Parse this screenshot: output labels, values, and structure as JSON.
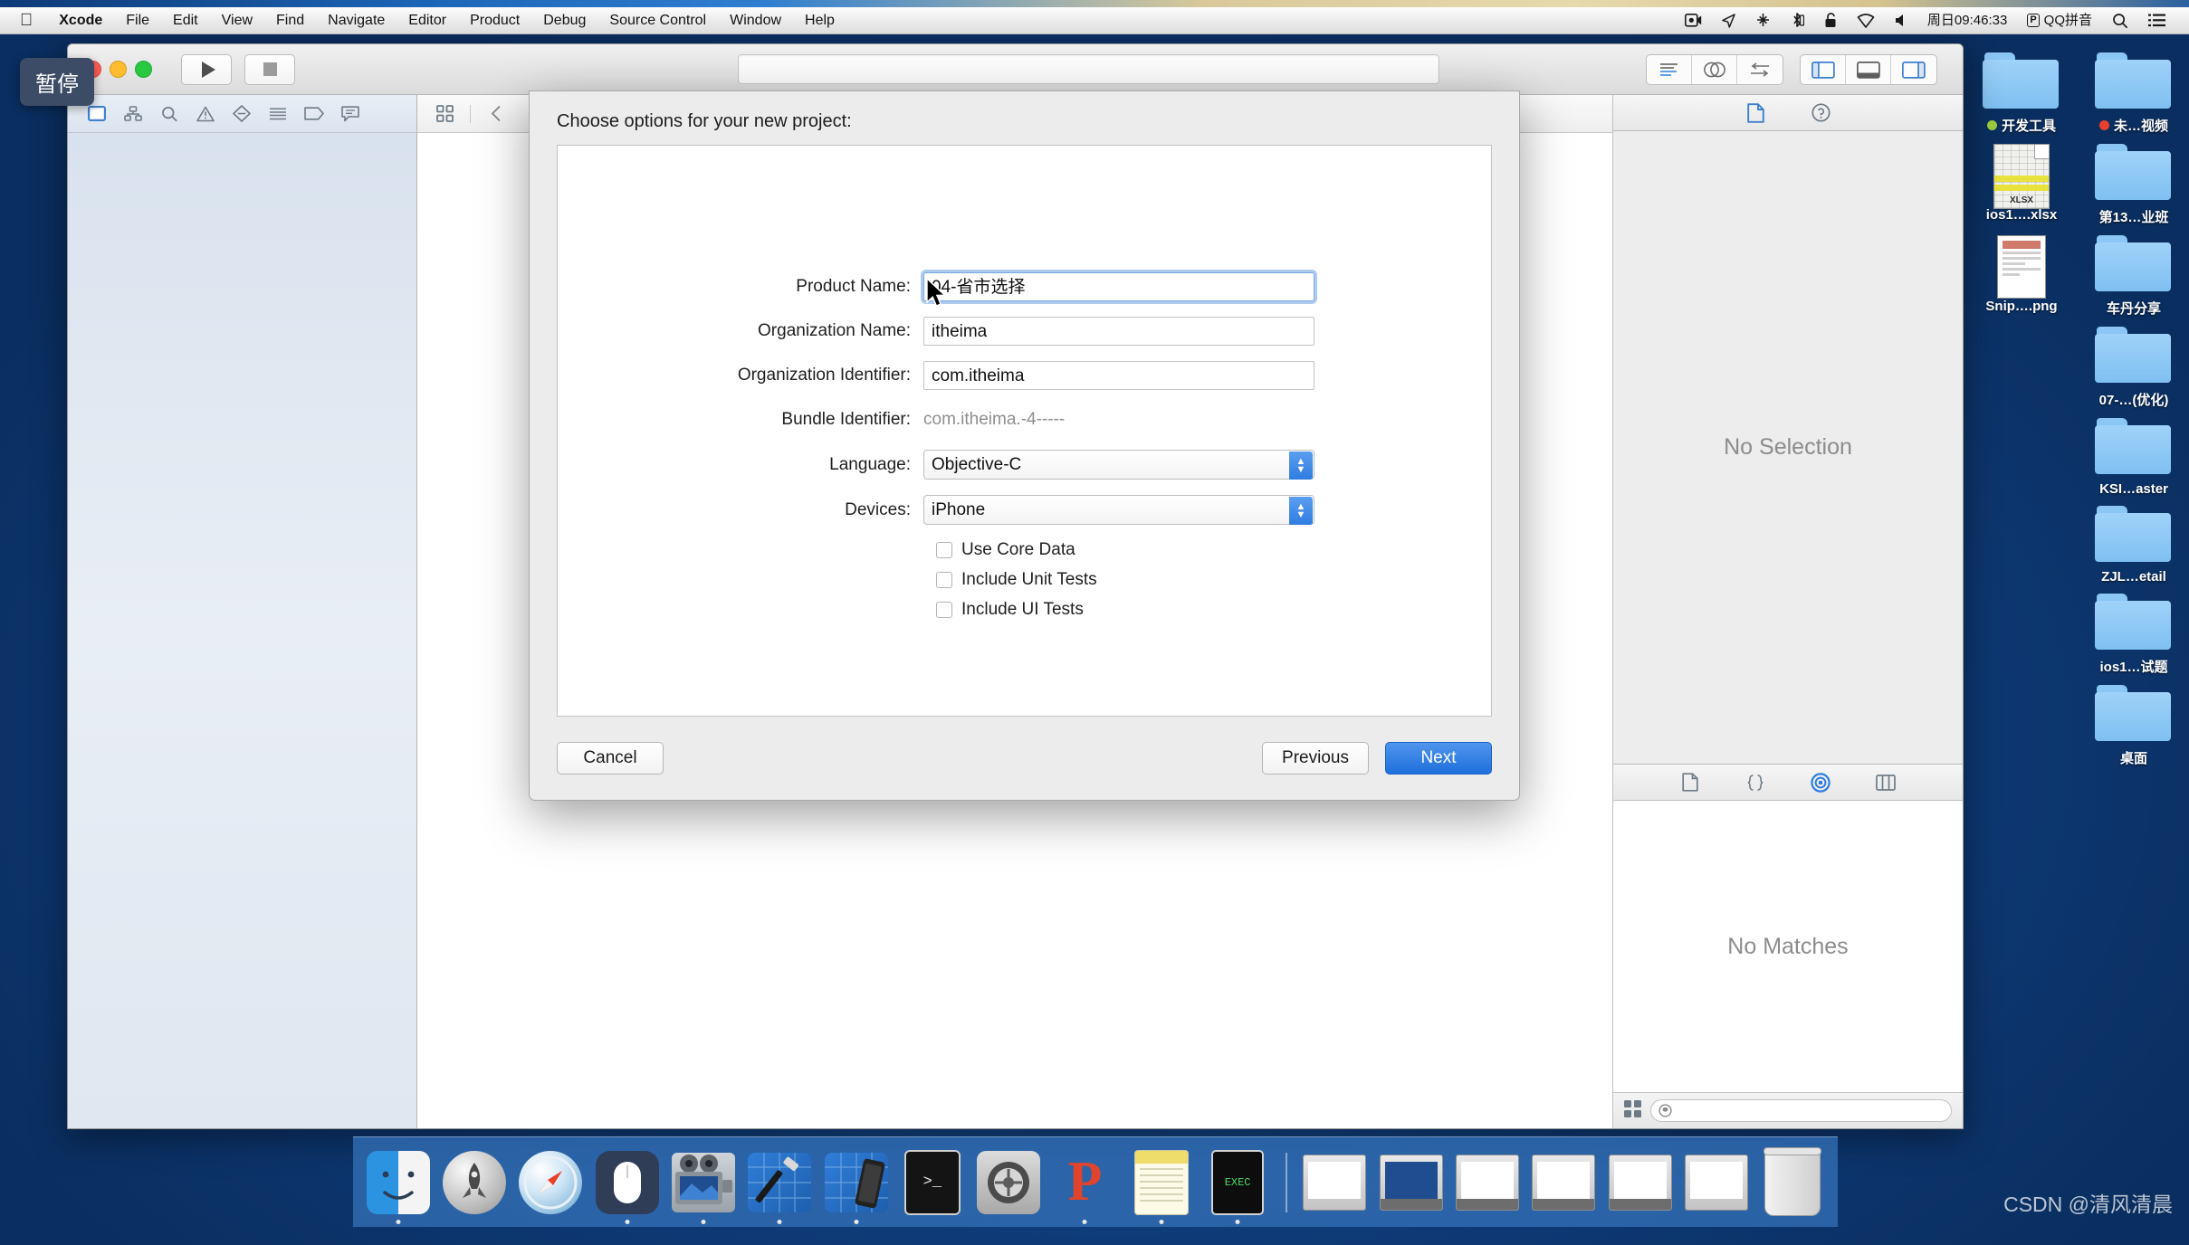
{
  "menubar": {
    "apple_icon": "apple-logo-icon",
    "items": [
      {
        "label": "Xcode",
        "bold": true
      },
      {
        "label": "File",
        "bold": false
      },
      {
        "label": "Edit",
        "bold": false
      },
      {
        "label": "View",
        "bold": false
      },
      {
        "label": "Find",
        "bold": false
      },
      {
        "label": "Navigate",
        "bold": false
      },
      {
        "label": "Editor",
        "bold": false
      },
      {
        "label": "Product",
        "bold": false
      },
      {
        "label": "Debug",
        "bold": false
      },
      {
        "label": "Source Control",
        "bold": false
      },
      {
        "label": "Window",
        "bold": false
      },
      {
        "label": "Help",
        "bold": false
      }
    ],
    "status": {
      "screen_recording_icon": "screen-recording-icon",
      "location_icon": "location-arrow-icon",
      "airdrop_icon": "airdrop-icon",
      "bluetooth_icon": "bluetooth-icon",
      "lock_icon": "lock-icon",
      "wifi_icon": "wifi-icon",
      "volume_icon": "volume-icon",
      "clock": "周日09:46:33",
      "ime_badge": "P",
      "ime_label": "QQ拼音",
      "search_icon": "search-icon",
      "control_center_icon": "control-center-icon"
    }
  },
  "pause_badge": {
    "label": "暂停"
  },
  "xcode": {
    "toolbar": {
      "run_icon": "run-play-icon",
      "stop_icon": "stop-square-icon",
      "editor_modes": [
        "standard-editor-icon",
        "assistant-editor-icon",
        "version-editor-icon"
      ],
      "view_toggles": [
        "navigator-toggle-icon",
        "debug-area-toggle-icon",
        "utilities-toggle-icon"
      ]
    },
    "navigator": {
      "tabs": [
        "project-navigator-icon",
        "symbol-navigator-icon",
        "find-navigator-icon",
        "issue-navigator-icon",
        "test-navigator-icon",
        "debug-navigator-icon",
        "breakpoint-navigator-icon",
        "report-navigator-icon"
      ]
    },
    "jumpbar": {
      "related_items_icon": "related-items-icon",
      "back_icon": "chevron-left-icon",
      "forward_icon": "chevron-right-icon"
    },
    "utilities": {
      "top_tabs": [
        "file-inspector-icon",
        "quick-help-icon"
      ],
      "top_empty_text": "No Selection",
      "bottom_tabs": [
        "file-template-library-icon",
        "code-snippet-library-icon",
        "object-library-icon",
        "media-library-icon"
      ],
      "bottom_empty_text": "No Matches",
      "library_grid_icon": "library-grid-icon",
      "library_filter_icon": "filter-icon",
      "library_filter_placeholder": ""
    }
  },
  "sheet": {
    "title": "Choose options for your new project:",
    "fields": [
      {
        "label": "Product Name:",
        "value": "04-省市选择",
        "type": "text",
        "focused": true
      },
      {
        "label": "Organization Name:",
        "value": "itheima",
        "type": "text",
        "focused": false
      },
      {
        "label": "Organization Identifier:",
        "value": "com.itheima",
        "type": "text",
        "focused": false
      },
      {
        "label": "Bundle Identifier:",
        "value": "com.itheima.-4-----",
        "type": "static",
        "focused": false
      },
      {
        "label": "Language:",
        "value": "Objective-C",
        "type": "select",
        "focused": false
      },
      {
        "label": "Devices:",
        "value": "iPhone",
        "type": "select",
        "focused": false
      }
    ],
    "checkboxes": [
      {
        "label": "Use Core Data",
        "checked": false
      },
      {
        "label": "Include Unit Tests",
        "checked": false
      },
      {
        "label": "Include UI Tests",
        "checked": false
      }
    ],
    "buttons": {
      "cancel": "Cancel",
      "previous": "Previous",
      "next": "Next"
    },
    "accent_color": "#1f6fdc"
  },
  "desktop": {
    "icons": [
      {
        "name": "开发工具",
        "kind": "folder",
        "tag": "#9ccc3f"
      },
      {
        "name": "未…视频",
        "kind": "folder",
        "tag": "#e8402a"
      },
      {
        "name": "ios1….xlsx",
        "kind": "xlsx",
        "tag": ""
      },
      {
        "name": "第13…业班",
        "kind": "folder",
        "tag": ""
      },
      {
        "name": "Snip….png",
        "kind": "png",
        "tag": ""
      },
      {
        "name": "车丹分享",
        "kind": "folder",
        "tag": ""
      },
      {
        "name": "",
        "kind": "folder",
        "tag": ""
      },
      {
        "name": "07-…(优化)",
        "kind": "folder",
        "tag": ""
      },
      {
        "name": "",
        "kind": "spacer",
        "tag": ""
      },
      {
        "name": "KSI…aster",
        "kind": "folder",
        "tag": ""
      },
      {
        "name": "",
        "kind": "spacer",
        "tag": ""
      },
      {
        "name": "ZJL…etail",
        "kind": "folder",
        "tag": ""
      },
      {
        "name": "",
        "kind": "spacer",
        "tag": ""
      },
      {
        "name": "ios1…试题",
        "kind": "folder",
        "tag": ""
      },
      {
        "name": "",
        "kind": "spacer",
        "tag": ""
      },
      {
        "name": "桌面",
        "kind": "folder",
        "tag": ""
      }
    ]
  },
  "dock": {
    "items": [
      {
        "name": "Finder",
        "kind": "finder",
        "running": true
      },
      {
        "name": "Launchpad",
        "kind": "launchpad",
        "running": false
      },
      {
        "name": "Safari",
        "kind": "safari",
        "running": false
      },
      {
        "name": "Mouse",
        "kind": "mouse",
        "running": true
      },
      {
        "name": "QuickTime Player",
        "kind": "quicktime",
        "running": true
      },
      {
        "name": "Xcode",
        "kind": "xcode",
        "running": true
      },
      {
        "name": "Simulator",
        "kind": "xcode-sim",
        "running": true
      },
      {
        "name": "Terminal",
        "kind": "terminal",
        "running": false
      },
      {
        "name": "System Preferences",
        "kind": "syspref",
        "running": false
      },
      {
        "name": "PowerPoint",
        "kind": "ppt",
        "running": true
      },
      {
        "name": "Notes",
        "kind": "notes",
        "running": true
      },
      {
        "name": "Exec",
        "kind": "exec",
        "running": true
      }
    ],
    "minimized": [
      {
        "name": "minimized-window-1",
        "kind": "mini-doc"
      },
      {
        "name": "minimized-window-2",
        "kind": "mini"
      },
      {
        "name": "minimized-window-3",
        "kind": "mini"
      },
      {
        "name": "minimized-window-4",
        "kind": "mini"
      },
      {
        "name": "minimized-window-5",
        "kind": "mini"
      },
      {
        "name": "minimized-window-6",
        "kind": "mini"
      }
    ],
    "trash": {
      "name": "Trash"
    }
  },
  "watermark": {
    "text": "CSDN @清风清晨"
  }
}
